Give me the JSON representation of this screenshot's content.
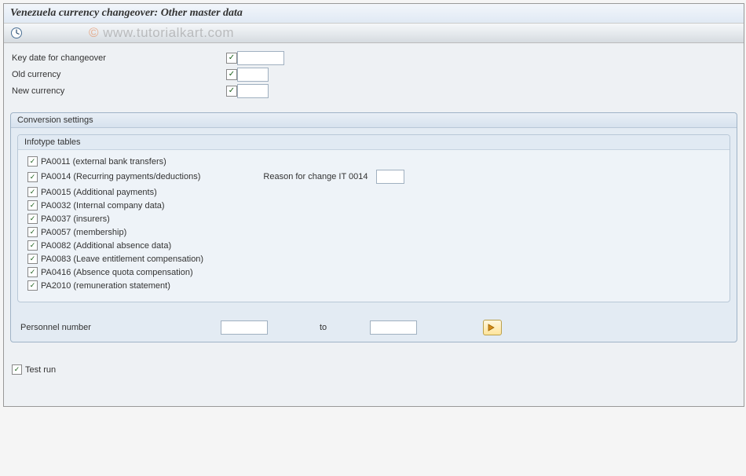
{
  "header": {
    "title": "Venezuela currency changeover: Other master data"
  },
  "watermark": "www.tutorialkart.com",
  "fields": {
    "key_date_label": "Key date for changeover",
    "old_currency_label": "Old currency",
    "new_currency_label": "New currency"
  },
  "conversion": {
    "group_title": "Conversion settings",
    "infotype_title": "Infotype tables",
    "items": [
      {
        "label": "PA0011 (external bank transfers)",
        "checked": true
      },
      {
        "label": "PA0014 (Recurring payments/deductions)",
        "checked": true,
        "reason": true
      },
      {
        "label": "PA0015 (Additional payments)",
        "checked": true
      },
      {
        "label": "PA0032 (Internal company data)",
        "checked": true
      },
      {
        "label": "PA0037 (insurers)",
        "checked": true
      },
      {
        "label": "PA0057 (membership)",
        "checked": true
      },
      {
        "label": "PA0082 (Additional absence data)",
        "checked": true
      },
      {
        "label": "PA0083 (Leave entitlement compensation)",
        "checked": true
      },
      {
        "label": "PA0416 (Absence quota compensation)",
        "checked": true
      },
      {
        "label": "PA2010 (remuneration statement)",
        "checked": true
      }
    ],
    "reason_label": "Reason for change IT 0014"
  },
  "selection": {
    "personnel_label": "Personnel number",
    "to_label": "to"
  },
  "testrun": {
    "label": "Test run",
    "checked": true
  }
}
